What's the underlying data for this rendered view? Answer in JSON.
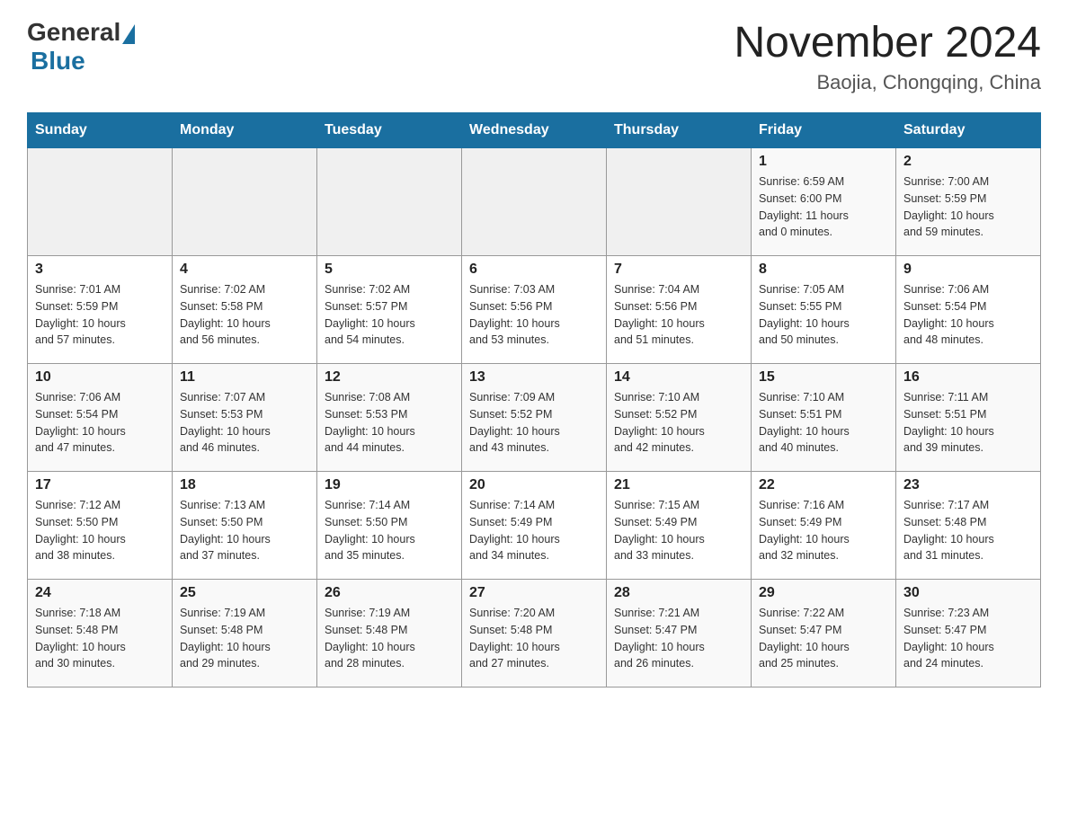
{
  "header": {
    "logo": {
      "general": "General",
      "blue": "Blue"
    },
    "title": "November 2024",
    "location": "Baojia, Chongqing, China"
  },
  "weekdays": [
    "Sunday",
    "Monday",
    "Tuesday",
    "Wednesday",
    "Thursday",
    "Friday",
    "Saturday"
  ],
  "weeks": [
    [
      {
        "day": "",
        "info": ""
      },
      {
        "day": "",
        "info": ""
      },
      {
        "day": "",
        "info": ""
      },
      {
        "day": "",
        "info": ""
      },
      {
        "day": "",
        "info": ""
      },
      {
        "day": "1",
        "info": "Sunrise: 6:59 AM\nSunset: 6:00 PM\nDaylight: 11 hours\nand 0 minutes."
      },
      {
        "day": "2",
        "info": "Sunrise: 7:00 AM\nSunset: 5:59 PM\nDaylight: 10 hours\nand 59 minutes."
      }
    ],
    [
      {
        "day": "3",
        "info": "Sunrise: 7:01 AM\nSunset: 5:59 PM\nDaylight: 10 hours\nand 57 minutes."
      },
      {
        "day": "4",
        "info": "Sunrise: 7:02 AM\nSunset: 5:58 PM\nDaylight: 10 hours\nand 56 minutes."
      },
      {
        "day": "5",
        "info": "Sunrise: 7:02 AM\nSunset: 5:57 PM\nDaylight: 10 hours\nand 54 minutes."
      },
      {
        "day": "6",
        "info": "Sunrise: 7:03 AM\nSunset: 5:56 PM\nDaylight: 10 hours\nand 53 minutes."
      },
      {
        "day": "7",
        "info": "Sunrise: 7:04 AM\nSunset: 5:56 PM\nDaylight: 10 hours\nand 51 minutes."
      },
      {
        "day": "8",
        "info": "Sunrise: 7:05 AM\nSunset: 5:55 PM\nDaylight: 10 hours\nand 50 minutes."
      },
      {
        "day": "9",
        "info": "Sunrise: 7:06 AM\nSunset: 5:54 PM\nDaylight: 10 hours\nand 48 minutes."
      }
    ],
    [
      {
        "day": "10",
        "info": "Sunrise: 7:06 AM\nSunset: 5:54 PM\nDaylight: 10 hours\nand 47 minutes."
      },
      {
        "day": "11",
        "info": "Sunrise: 7:07 AM\nSunset: 5:53 PM\nDaylight: 10 hours\nand 46 minutes."
      },
      {
        "day": "12",
        "info": "Sunrise: 7:08 AM\nSunset: 5:53 PM\nDaylight: 10 hours\nand 44 minutes."
      },
      {
        "day": "13",
        "info": "Sunrise: 7:09 AM\nSunset: 5:52 PM\nDaylight: 10 hours\nand 43 minutes."
      },
      {
        "day": "14",
        "info": "Sunrise: 7:10 AM\nSunset: 5:52 PM\nDaylight: 10 hours\nand 42 minutes."
      },
      {
        "day": "15",
        "info": "Sunrise: 7:10 AM\nSunset: 5:51 PM\nDaylight: 10 hours\nand 40 minutes."
      },
      {
        "day": "16",
        "info": "Sunrise: 7:11 AM\nSunset: 5:51 PM\nDaylight: 10 hours\nand 39 minutes."
      }
    ],
    [
      {
        "day": "17",
        "info": "Sunrise: 7:12 AM\nSunset: 5:50 PM\nDaylight: 10 hours\nand 38 minutes."
      },
      {
        "day": "18",
        "info": "Sunrise: 7:13 AM\nSunset: 5:50 PM\nDaylight: 10 hours\nand 37 minutes."
      },
      {
        "day": "19",
        "info": "Sunrise: 7:14 AM\nSunset: 5:50 PM\nDaylight: 10 hours\nand 35 minutes."
      },
      {
        "day": "20",
        "info": "Sunrise: 7:14 AM\nSunset: 5:49 PM\nDaylight: 10 hours\nand 34 minutes."
      },
      {
        "day": "21",
        "info": "Sunrise: 7:15 AM\nSunset: 5:49 PM\nDaylight: 10 hours\nand 33 minutes."
      },
      {
        "day": "22",
        "info": "Sunrise: 7:16 AM\nSunset: 5:49 PM\nDaylight: 10 hours\nand 32 minutes."
      },
      {
        "day": "23",
        "info": "Sunrise: 7:17 AM\nSunset: 5:48 PM\nDaylight: 10 hours\nand 31 minutes."
      }
    ],
    [
      {
        "day": "24",
        "info": "Sunrise: 7:18 AM\nSunset: 5:48 PM\nDaylight: 10 hours\nand 30 minutes."
      },
      {
        "day": "25",
        "info": "Sunrise: 7:19 AM\nSunset: 5:48 PM\nDaylight: 10 hours\nand 29 minutes."
      },
      {
        "day": "26",
        "info": "Sunrise: 7:19 AM\nSunset: 5:48 PM\nDaylight: 10 hours\nand 28 minutes."
      },
      {
        "day": "27",
        "info": "Sunrise: 7:20 AM\nSunset: 5:48 PM\nDaylight: 10 hours\nand 27 minutes."
      },
      {
        "day": "28",
        "info": "Sunrise: 7:21 AM\nSunset: 5:47 PM\nDaylight: 10 hours\nand 26 minutes."
      },
      {
        "day": "29",
        "info": "Sunrise: 7:22 AM\nSunset: 5:47 PM\nDaylight: 10 hours\nand 25 minutes."
      },
      {
        "day": "30",
        "info": "Sunrise: 7:23 AM\nSunset: 5:47 PM\nDaylight: 10 hours\nand 24 minutes."
      }
    ]
  ]
}
